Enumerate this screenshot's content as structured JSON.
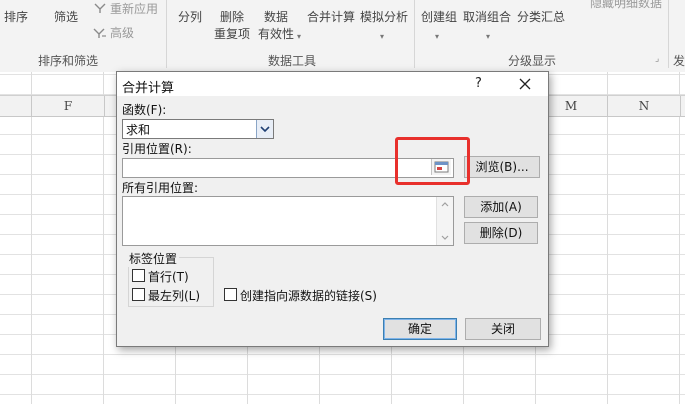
{
  "ribbon": {
    "sort_label": "排序",
    "filter_label": "筛选",
    "reapply_label": "重新应用",
    "advanced_label": "高级",
    "group_sort_filter": "排序和筛选",
    "split_label": "分列",
    "remove_dup_line1": "删除",
    "remove_dup_line2": "重复项",
    "validation_line1": "数据",
    "validation_line2": "有效性",
    "consolidate_label": "合并计算",
    "whatif_label": "模拟分析",
    "group_data_tools": "数据工具",
    "group_label": "创建组",
    "ungroup_label": "取消组合",
    "subtotal_label": "分类汇总",
    "hide_detail_label": "隐藏明细数据",
    "group_outline": "分级显示",
    "extra_label": "发"
  },
  "sheet": {
    "columns": [
      "F",
      "M",
      "N"
    ]
  },
  "dialog": {
    "title": "合并计算",
    "help": "?",
    "function_label": "函数(F):",
    "function_value": "求和",
    "reference_label": "引用位置(R):",
    "browse_button": "浏览(B)...",
    "all_refs_label": "所有引用位置:",
    "add_button": "添加(A)",
    "delete_button": "删除(D)",
    "labels_group": "标签位置",
    "top_row": "首行(T)",
    "left_column": "最左列(L)",
    "create_links": "创建指向源数据的链接(S)",
    "ok_button": "确定",
    "close_button": "关闭"
  },
  "colors": {
    "highlight": "#e8302c",
    "dialog_bg": "#f0f0f0",
    "ribbon_bg": "#f3f3f3"
  }
}
